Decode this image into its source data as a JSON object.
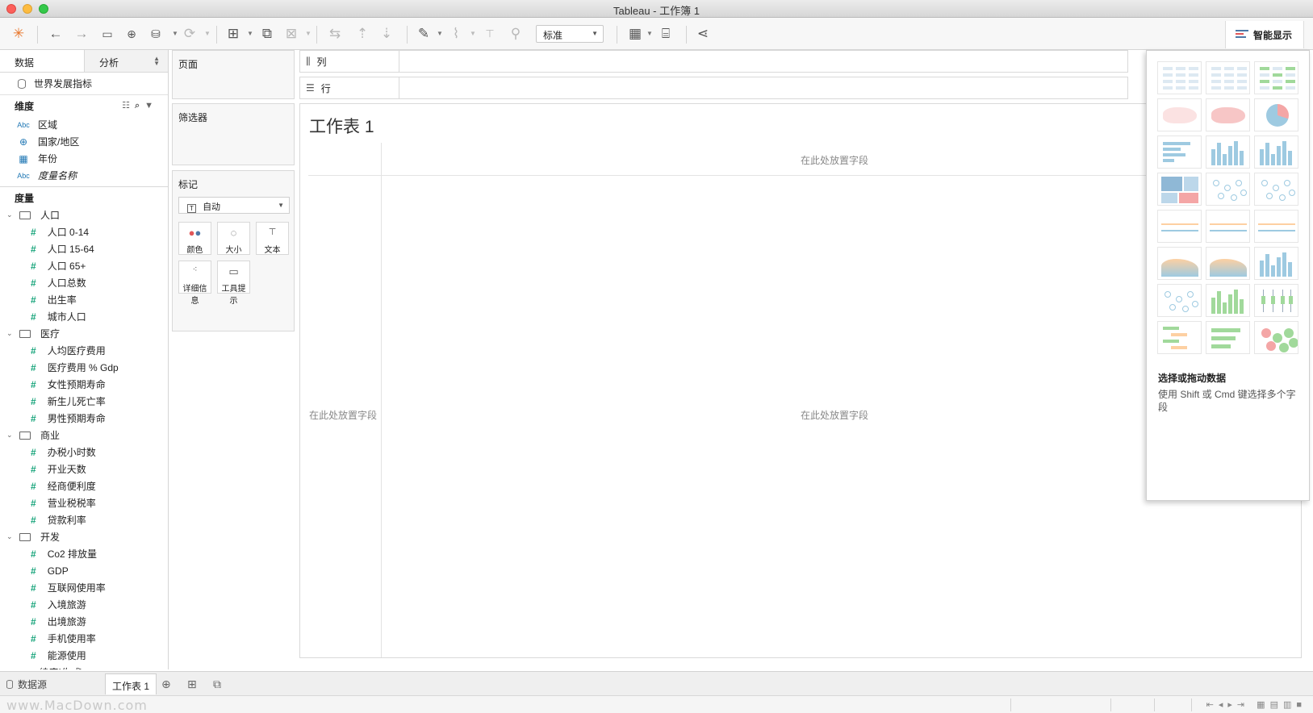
{
  "window": {
    "title": "Tableau - 工作簿 1"
  },
  "toolbar": {
    "fit_select": "标准",
    "show_me_label": "智能显示"
  },
  "data_pane": {
    "tabs": [
      "数据",
      "分析"
    ],
    "datasource": "世界发展指标",
    "dimensions_header": "维度",
    "dimensions": [
      {
        "type": "Abc",
        "name": "区域",
        "italic": false
      },
      {
        "type": "globe",
        "name": "国家/地区",
        "italic": false
      },
      {
        "type": "calendar",
        "name": "年份",
        "italic": false
      },
      {
        "type": "Abc",
        "name": "度量名称",
        "italic": true
      }
    ],
    "measures_header": "度量",
    "folders": [
      {
        "name": "人口",
        "items": [
          "人口 0-14",
          "人口 15-64",
          "人口 65+",
          "人口总数",
          "出生率",
          "城市人口"
        ]
      },
      {
        "name": "医疗",
        "items": [
          "人均医疗费用",
          "医疗费用 % Gdp",
          "女性预期寿命",
          "新生儿死亡率",
          "男性预期寿命"
        ]
      },
      {
        "name": "商业",
        "items": [
          "办税小时数",
          "开业天数",
          "经商便利度",
          "营业税税率",
          "贷款利率"
        ]
      },
      {
        "name": "开发",
        "items": [
          "Co2 排放量",
          "GDP",
          "互联网使用率",
          "入境旅游",
          "出境旅游",
          "手机使用率",
          "能源使用"
        ]
      }
    ],
    "cutoff_item": "纬度(生成)"
  },
  "cards": {
    "pages": "页面",
    "filters": "筛选器",
    "marks": "标记",
    "marks_type": "自动",
    "marks_buttons": [
      "颜色",
      "大小",
      "文本",
      "详细信息",
      "工具提示"
    ]
  },
  "shelves": {
    "columns": "列",
    "rows": "行"
  },
  "worksheet": {
    "title": "工作表 1",
    "drop_top": "在此处放置字段",
    "drop_left": "在此处放置字段",
    "drop_center": "在此处放置字段"
  },
  "show_me": {
    "hint_title": "选择或拖动数据",
    "hint_text": "使用 Shift 或 Cmd 键选择多个字段"
  },
  "sheet_tabs": {
    "datasource": "数据源",
    "sheet": "工作表 1"
  },
  "status": {
    "watermark": "www.MacDown.com"
  },
  "colors": {
    "measure_green": "#1aa57c",
    "dimension_blue": "#1f77b4",
    "thumb_blue": "#9ecae1",
    "thumb_green": "#a1d99b",
    "thumb_orange": "#fdd0a2",
    "thumb_red": "#f4a6a6"
  }
}
